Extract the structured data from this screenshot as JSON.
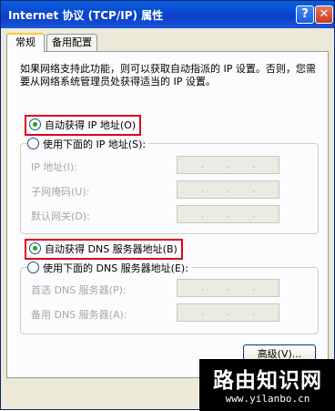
{
  "window": {
    "title": "Internet 协议 (TCP/IP) 属性",
    "help_btn": "?",
    "close_btn": "✕"
  },
  "tabs": [
    {
      "label": "常规",
      "active": true
    },
    {
      "label": "备用配置",
      "active": false
    }
  ],
  "description": "如果网络支持此功能，则可以获取自动指派的 IP 设置。否则，您需要从网络系统管理员处获得适当的 IP 设置。",
  "ip": {
    "auto_label": "自动获得 IP 地址(O)",
    "manual_label": "使用下面的 IP 地址(S):",
    "auto_selected": true,
    "fields": [
      {
        "label": "IP 地址(I):",
        "value": ""
      },
      {
        "label": "子网掩码(U):",
        "value": ""
      },
      {
        "label": "默认网关(D):",
        "value": ""
      }
    ]
  },
  "dns": {
    "auto_label": "自动获得 DNS 服务器地址(B)",
    "manual_label": "使用下面的 DNS 服务器地址(E):",
    "auto_selected": true,
    "fields": [
      {
        "label": "首选 DNS 服务器(P):",
        "value": ""
      },
      {
        "label": "备用 DNS 服务器(A):",
        "value": ""
      }
    ]
  },
  "advanced_button": "高级(V)...",
  "watermark": {
    "title": "路由知识网",
    "url": "www.yilanbo.cn"
  },
  "colors": {
    "title_bar": "#0a4fd8",
    "highlight": "#e0001a",
    "selected_radio": "#21a121"
  }
}
